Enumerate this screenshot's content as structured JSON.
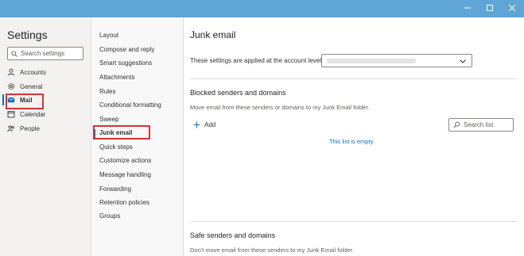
{
  "left_pane": {
    "title": "Settings",
    "search_placeholder": "Search settings",
    "categories": [
      {
        "label": "Accounts",
        "icon": "person-icon"
      },
      {
        "label": "General",
        "icon": "gear-icon"
      },
      {
        "label": "Mail",
        "icon": "mail-icon",
        "selected": true
      },
      {
        "label": "Calendar",
        "icon": "calendar-icon"
      },
      {
        "label": "People",
        "icon": "people-icon"
      }
    ]
  },
  "mid_pane": {
    "items": [
      "Layout",
      "Compose and reply",
      "Smart suggestions",
      "Attachments",
      "Rules",
      "Conditional formatting",
      "Sweep",
      "Junk email",
      "Quick steps",
      "Customize actions",
      "Message handling",
      "Forwarding",
      "Retention policies",
      "Groups"
    ],
    "selected_index": 7
  },
  "right_pane": {
    "title": "Junk email",
    "account_level_label": "These settings are applied at the account level:",
    "blocked": {
      "heading": "Blocked senders and domains",
      "description": "Move email from these senders or domains to my Junk Email folder.",
      "add_label": "Add",
      "search_placeholder": "Search list",
      "empty_text": "This list is empty."
    },
    "safe": {
      "heading": "Safe senders and domains",
      "description": "Don't move email from these senders to my Junk Email folder."
    }
  },
  "colors": {
    "accent": "#0f6cbd",
    "highlight": "#d13438",
    "titlebar": "#5fa6d6"
  }
}
